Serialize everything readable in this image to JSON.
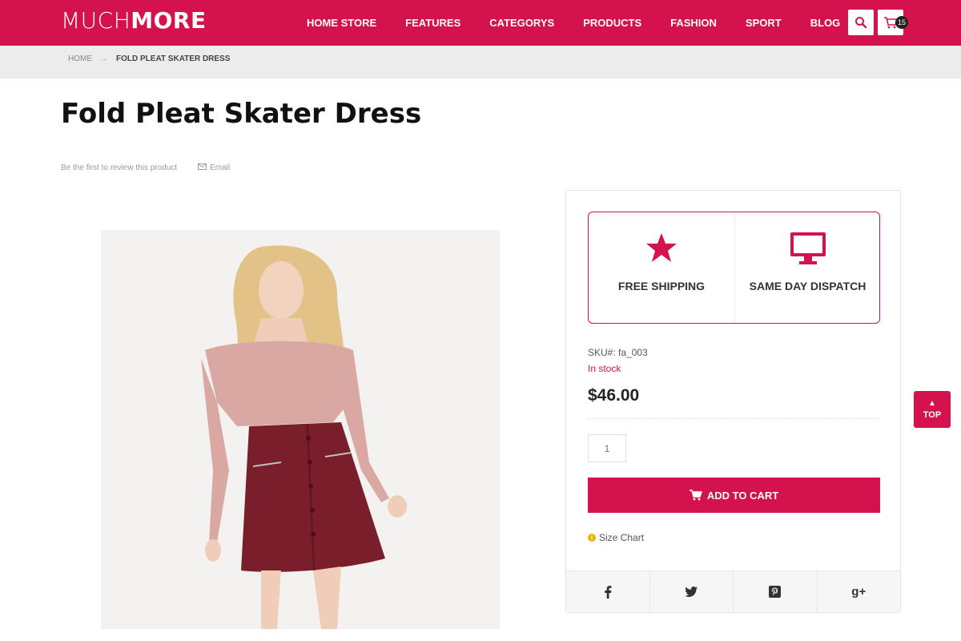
{
  "brand": {
    "light": "MUCH",
    "bold": "MORE"
  },
  "nav": [
    "HOME STORE",
    "FEATURES",
    "CATEGORYS",
    "PRODUCTS",
    "FASHION",
    "SPORT",
    "BLOG"
  ],
  "cart": {
    "count": "15"
  },
  "breadcrumb": {
    "home": "HOME",
    "separator": "→",
    "current": "FOLD PLEAT SKATER DRESS"
  },
  "product": {
    "title": "Fold Pleat Skater Dress",
    "review_text": "Be the first to review this product",
    "email_label": "Email",
    "sku_label": "SKU#:",
    "sku_value": "fa_003",
    "stock": "In stock",
    "price": "$46.00",
    "qty_placeholder": "1",
    "add_to_cart": "ADD TO CART",
    "size_chart": "Size Chart"
  },
  "features": [
    {
      "icon": "star-icon",
      "label": "FREE SHIPPING"
    },
    {
      "icon": "monitor-icon",
      "label": "SAME DAY DISPATCH"
    }
  ],
  "social": [
    "f",
    "twitter",
    "pinterest",
    "g+"
  ],
  "back_to_top": "TOP",
  "colors": {
    "accent": "#d4134e",
    "breadcrumb_bg": "#ececec"
  }
}
